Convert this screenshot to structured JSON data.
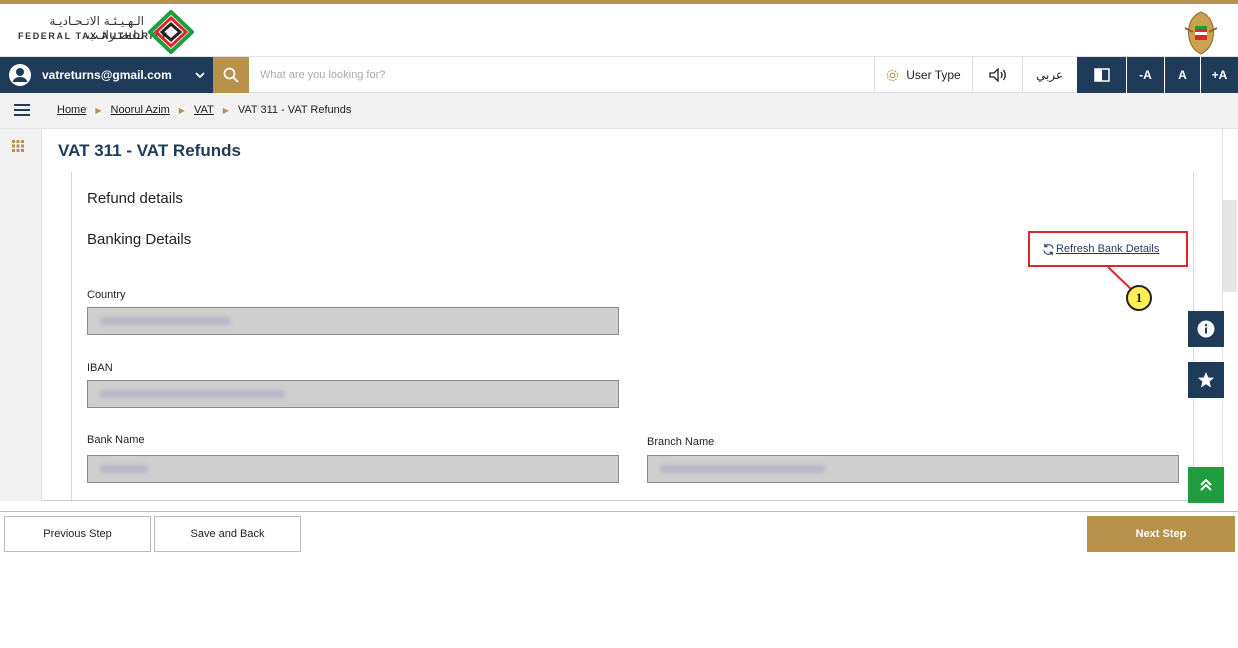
{
  "header": {
    "logo_ar": "الـهـيـئـة الاتـحـاديـة لـلـضـرائـب",
    "logo_en": "FEDERAL TAX AUTHORITY"
  },
  "navbar": {
    "user_email": "vatreturns@gmail.com",
    "search_placeholder": "What are you looking for?",
    "user_type_label": "User Type",
    "arabic_label": "عربي",
    "font_decrease": "-A",
    "font_normal": "A",
    "font_increase": "+A"
  },
  "breadcrumb": {
    "items": [
      "Home",
      "Noorul Azim",
      "VAT"
    ],
    "current": "VAT 311 - VAT Refunds"
  },
  "page": {
    "title": "VAT 311 - VAT Refunds",
    "refund_details_heading": "Refund details",
    "banking_details_heading": "Banking Details",
    "refresh_link": "Refresh Bank Details",
    "callout_number": "1"
  },
  "fields": {
    "country_label": "Country",
    "iban_label": "IBAN",
    "bank_name_label": "Bank Name",
    "branch_name_label": "Branch Name"
  },
  "footer": {
    "previous_step": "Previous Step",
    "save_and_back": "Save and Back",
    "next_step": "Next Step"
  },
  "colors": {
    "navy": "#1f3b5a",
    "gold": "#b8914a",
    "green": "#1e9e3e",
    "callout_red": "#e0262b",
    "callout_yellow": "#ffee55"
  },
  "icons": [
    "user-icon",
    "chevron-down-icon",
    "search-icon",
    "gear-icon",
    "speaker-icon",
    "contrast-icon",
    "menu-icon",
    "grid-icon",
    "refresh-icon",
    "info-icon",
    "star-icon",
    "double-chevron-up-icon"
  ]
}
